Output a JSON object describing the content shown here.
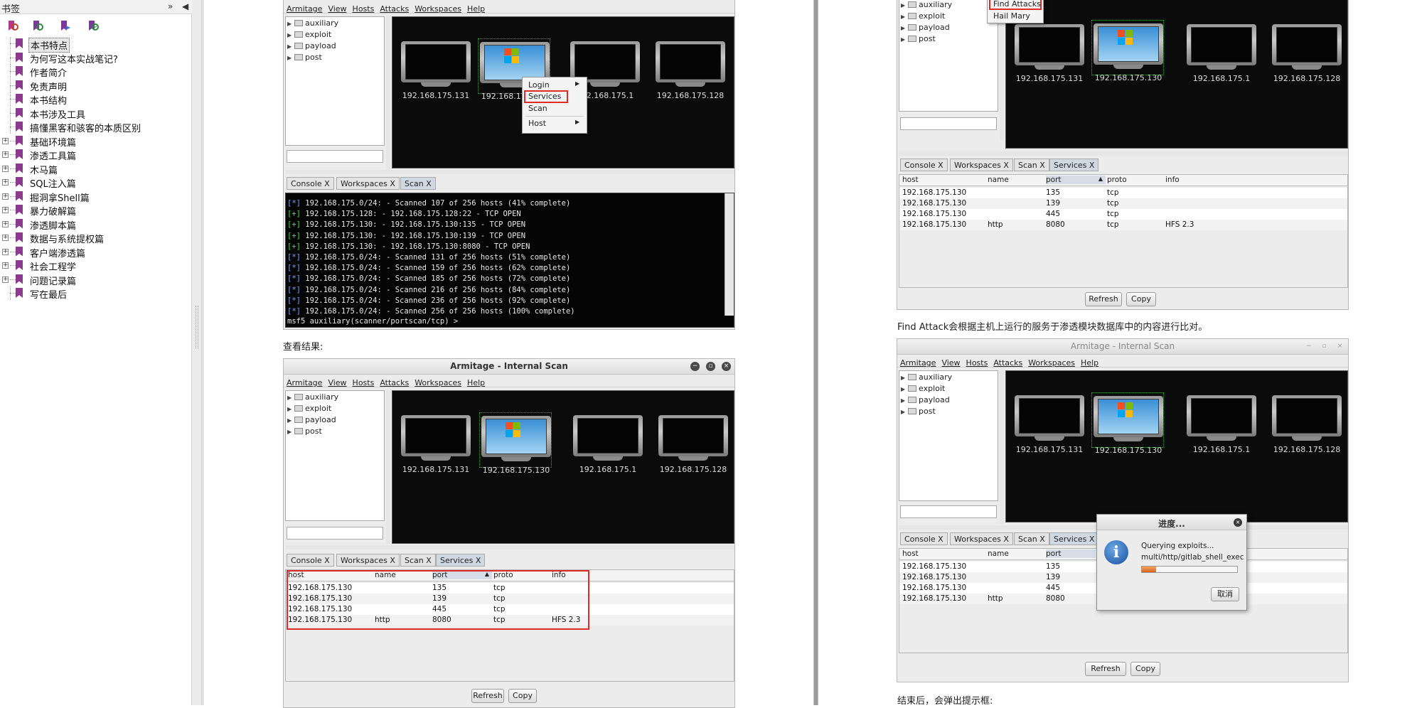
{
  "sidebar": {
    "title": "书签",
    "controls": {
      "expand": "»",
      "collapse": "◀"
    },
    "items": [
      {
        "label": "本书特点",
        "expandable": false,
        "selected": true
      },
      {
        "label": "为何写这本实战笔记?",
        "expandable": false
      },
      {
        "label": "作者简介",
        "expandable": false
      },
      {
        "label": "免责声明",
        "expandable": false
      },
      {
        "label": "本书结构",
        "expandable": false
      },
      {
        "label": "本书涉及工具",
        "expandable": false
      },
      {
        "label": "搞懂黑客和骇客的本质区别",
        "expandable": false
      },
      {
        "label": "基础环境篇",
        "expandable": true
      },
      {
        "label": "渗透工具篇",
        "expandable": true
      },
      {
        "label": "木马篇",
        "expandable": true
      },
      {
        "label": "SQL注入篇",
        "expandable": true
      },
      {
        "label": "掘洞拿Shell篇",
        "expandable": true
      },
      {
        "label": "暴力破解篇",
        "expandable": true
      },
      {
        "label": "渗透脚本篇",
        "expandable": true
      },
      {
        "label": "数据与系统提权篇",
        "expandable": true
      },
      {
        "label": "客户端渗透篇",
        "expandable": true
      },
      {
        "label": "社会工程学",
        "expandable": true
      },
      {
        "label": "问题记录篇",
        "expandable": true
      },
      {
        "label": "写在最后",
        "expandable": false
      }
    ]
  },
  "armitage": {
    "menu": [
      "Armitage",
      "View",
      "Hosts",
      "Attacks",
      "Workspaces",
      "Help"
    ],
    "tree": [
      "auxiliary",
      "exploit",
      "payload",
      "post"
    ],
    "hosts": [
      "192.168.175.131",
      "192.168.175.130",
      "192.168.175.1",
      "192.168.175.128"
    ],
    "table_headers": [
      "host",
      "name",
      "port",
      "proto",
      "info"
    ],
    "services": [
      {
        "host": "192.168.175.130",
        "name": "",
        "port": "135",
        "proto": "tcp",
        "info": ""
      },
      {
        "host": "192.168.175.130",
        "name": "",
        "port": "139",
        "proto": "tcp",
        "info": ""
      },
      {
        "host": "192.168.175.130",
        "name": "",
        "port": "445",
        "proto": "tcp",
        "info": ""
      },
      {
        "host": "192.168.175.130",
        "name": "http",
        "port": "8080",
        "proto": "tcp",
        "info": "HFS 2.3"
      }
    ],
    "buttons": {
      "refresh": "Refresh",
      "copy": "Copy"
    }
  },
  "left_page": {
    "top_window": {
      "tabs": [
        "Console X",
        "Workspaces X",
        "Scan X"
      ],
      "context_menu": [
        "Login",
        "Services",
        "Scan",
        "Host"
      ],
      "console_lines": [
        {
          "tag": "[*]",
          "ip": "192.168.175.0/24:",
          "msg": " - Scanned 107 of 256 hosts (41% complete)"
        },
        {
          "tag": "[+]",
          "ip": "192.168.175.128:",
          "msg": " - 192.168.175.128:22 - TCP OPEN"
        },
        {
          "tag": "[+]",
          "ip": "192.168.175.130:",
          "msg": " - 192.168.175.130:135 - TCP OPEN"
        },
        {
          "tag": "[+]",
          "ip": "192.168.175.130:",
          "msg": " - 192.168.175.130:139 - TCP OPEN"
        },
        {
          "tag": "[+]",
          "ip": "192.168.175.130:",
          "msg": " - 192.168.175.130:8080 - TCP OPEN"
        },
        {
          "tag": "[*]",
          "ip": "192.168.175.0/24:",
          "msg": " - Scanned 131 of 256 hosts (51% complete)"
        },
        {
          "tag": "[*]",
          "ip": "192.168.175.0/24:",
          "msg": " - Scanned 159 of 256 hosts (62% complete)"
        },
        {
          "tag": "[*]",
          "ip": "192.168.175.0/24:",
          "msg": " - Scanned 185 of 256 hosts (72% complete)"
        },
        {
          "tag": "[*]",
          "ip": "192.168.175.0/24:",
          "msg": " - Scanned 216 of 256 hosts (84% complete)"
        },
        {
          "tag": "[*]",
          "ip": "192.168.175.0/24:",
          "msg": " - Scanned 236 of 256 hosts (92% complete)"
        },
        {
          "tag": "[*]",
          "ip": "192.168.175.0/24:",
          "msg": " - Scanned 256 of 256 hosts (100% complete)"
        }
      ],
      "prompt": "msf5 auxiliary(scanner/portscan/tcp) >"
    },
    "caption_view_results": "查看结果:",
    "bottom_window": {
      "title": "Armitage - Internal Scan",
      "tabs": [
        "Console X",
        "Workspaces X",
        "Scan X",
        "Services X"
      ]
    }
  },
  "right_page": {
    "top_window": {
      "context_menu": [
        "Find Attacks",
        "Hail Mary"
      ],
      "tabs": [
        "Console X",
        "Workspaces X",
        "Scan X",
        "Services X"
      ]
    },
    "caption_find_attack": "Find Attack会根据主机上运行的服务于渗透模块数据库中的内容进行比对。",
    "bottom_window": {
      "title": "Armitage - Internal Scan",
      "tabs": [
        "Console X",
        "Workspaces X",
        "Scan X",
        "Services X"
      ]
    },
    "progress_dialog": {
      "title": "进度...",
      "line1": "Querying exploits...",
      "line2": "multi/http/gitlab_shell_exec",
      "progress": 0.15,
      "cancel": "取消"
    },
    "caption_after": "结束后，会弹出提示框:"
  },
  "colors": {
    "highlight_red": "#e02a2a",
    "select_green": "#1fb51f",
    "console_bg": "#050505"
  }
}
